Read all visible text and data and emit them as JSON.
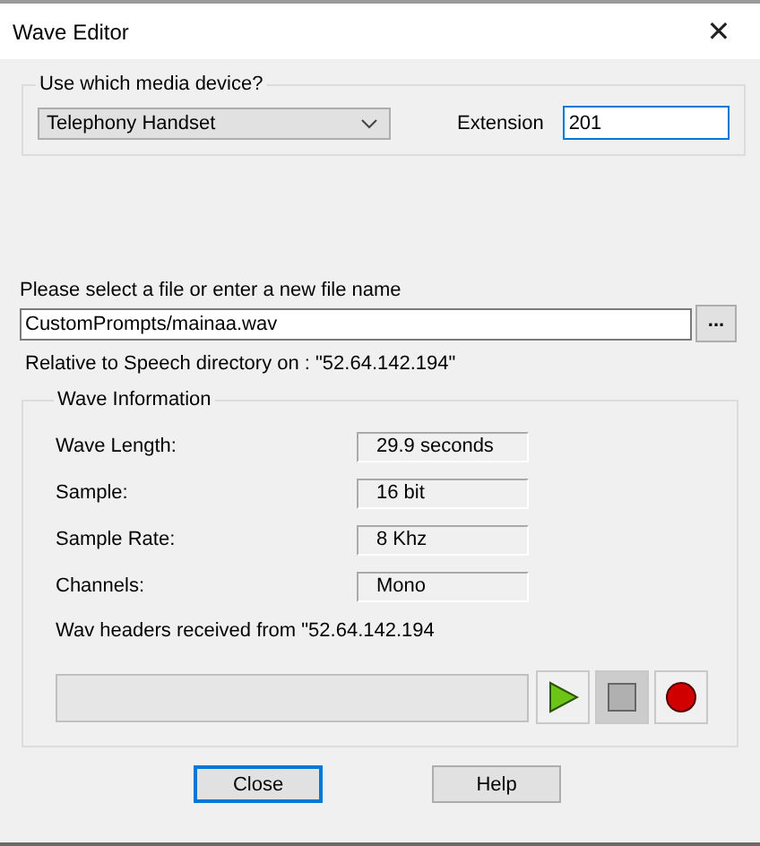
{
  "window": {
    "title": "Wave Editor",
    "close": "✕"
  },
  "device_group": {
    "title": "Use which media device?",
    "device": "Telephony Handset",
    "extension_label": "Extension",
    "extension": "201"
  },
  "file": {
    "label": "Please select a file or enter a new file name",
    "value": "CustomPrompts/mainaa.wav",
    "browse": "...",
    "relative": "Relative to Speech directory on : \"52.64.142.194\""
  },
  "wave_group": {
    "title": "Wave Information",
    "fields": [
      {
        "label": "Wave Length:",
        "value": "29.9 seconds"
      },
      {
        "label": "Sample:",
        "value": "16 bit"
      },
      {
        "label": "Sample Rate:",
        "value": "8 Khz"
      },
      {
        "label": "Channels:",
        "value": "Mono"
      }
    ],
    "headers": "Wav headers received from \"52.64.142.194",
    "controls": [
      {
        "kind": "play",
        "disabled": false
      },
      {
        "kind": "stop",
        "disabled": true
      },
      {
        "kind": "record",
        "disabled": false
      }
    ]
  },
  "buttons": [
    {
      "label": "Close",
      "default": true
    },
    {
      "label": "Help",
      "default": false
    }
  ]
}
